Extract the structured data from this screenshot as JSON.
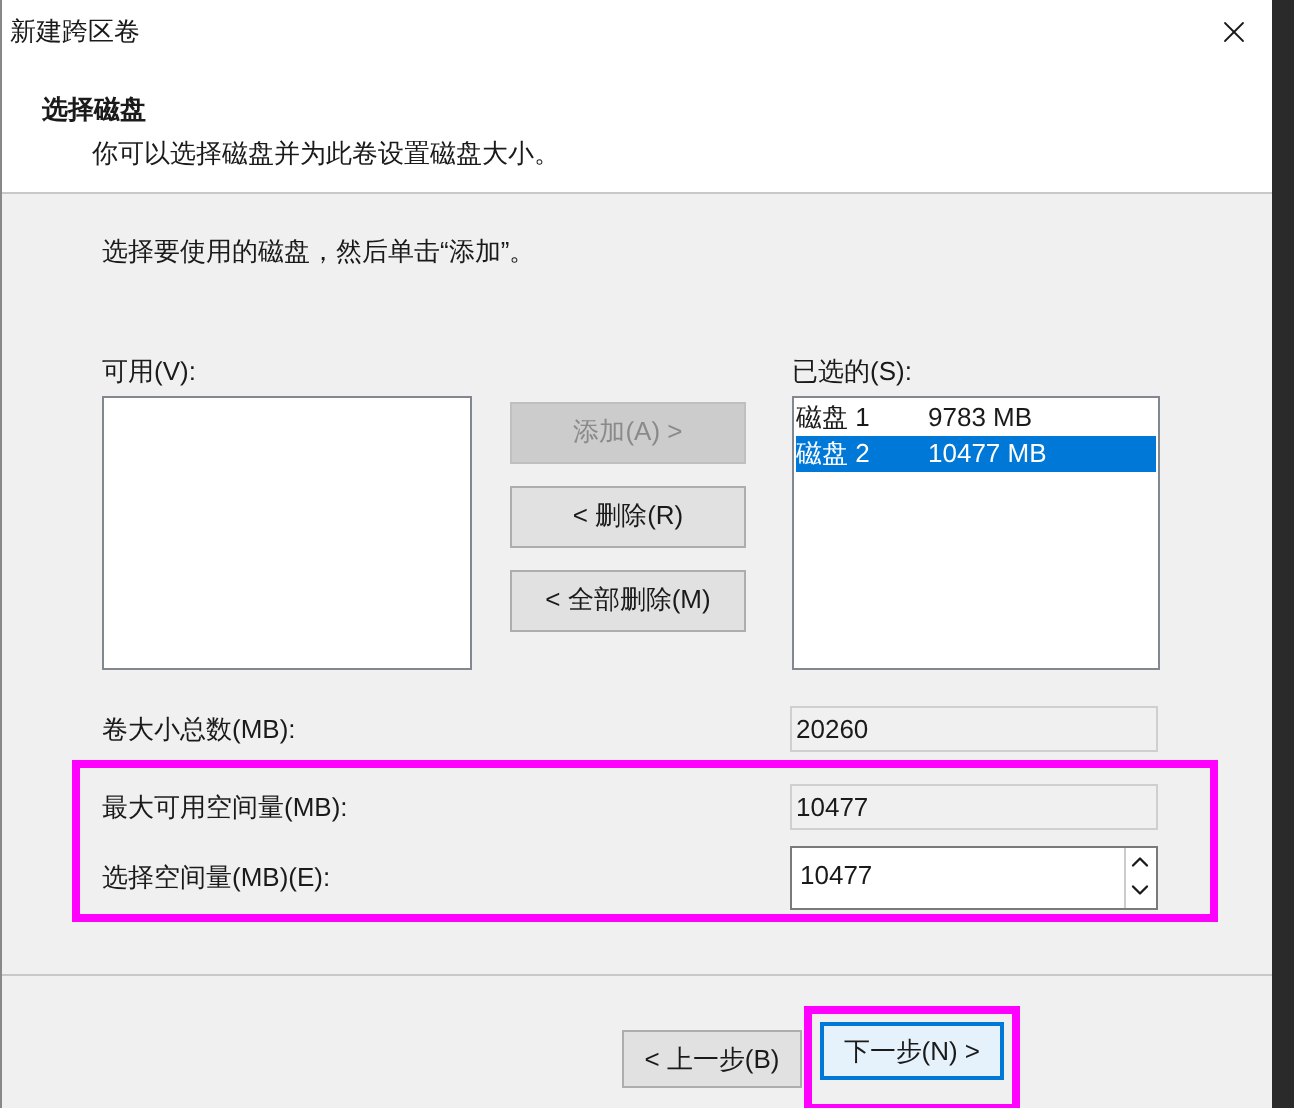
{
  "window": {
    "title": "新建跨区卷"
  },
  "header": {
    "title": "选择磁盘",
    "subtitle": "你可以选择磁盘并为此卷设置磁盘大小。"
  },
  "instruction": "选择要使用的磁盘，然后单击“添加”。",
  "available": {
    "label": "可用(V):"
  },
  "selected": {
    "label": "已选的(S):",
    "items": [
      {
        "name": "磁盘 1",
        "size": "9783 MB",
        "selected": false
      },
      {
        "name": "磁盘 2",
        "size": "10477 MB",
        "selected": true
      }
    ]
  },
  "move_buttons": [
    {
      "label": "添加(A) >",
      "disabled": true
    },
    {
      "label": "< 删除(R)",
      "disabled": false
    },
    {
      "label": "< 全部删除(M)",
      "disabled": false
    }
  ],
  "fields": [
    {
      "kind": "readonly",
      "label": "卷大小总数(MB):",
      "value": "20260",
      "highlighted": false
    },
    {
      "kind": "readonly",
      "label": "最大可用空间量(MB):",
      "value": "10477",
      "highlighted": true
    },
    {
      "kind": "spinner",
      "label": "选择空间量(MB)(E):",
      "value": "10477",
      "highlighted": true
    }
  ],
  "footer_buttons": [
    {
      "label": "< 上一步(B)",
      "default": false,
      "highlighted": false
    },
    {
      "label": "下一步(N) >",
      "default": true,
      "highlighted": true
    }
  ]
}
